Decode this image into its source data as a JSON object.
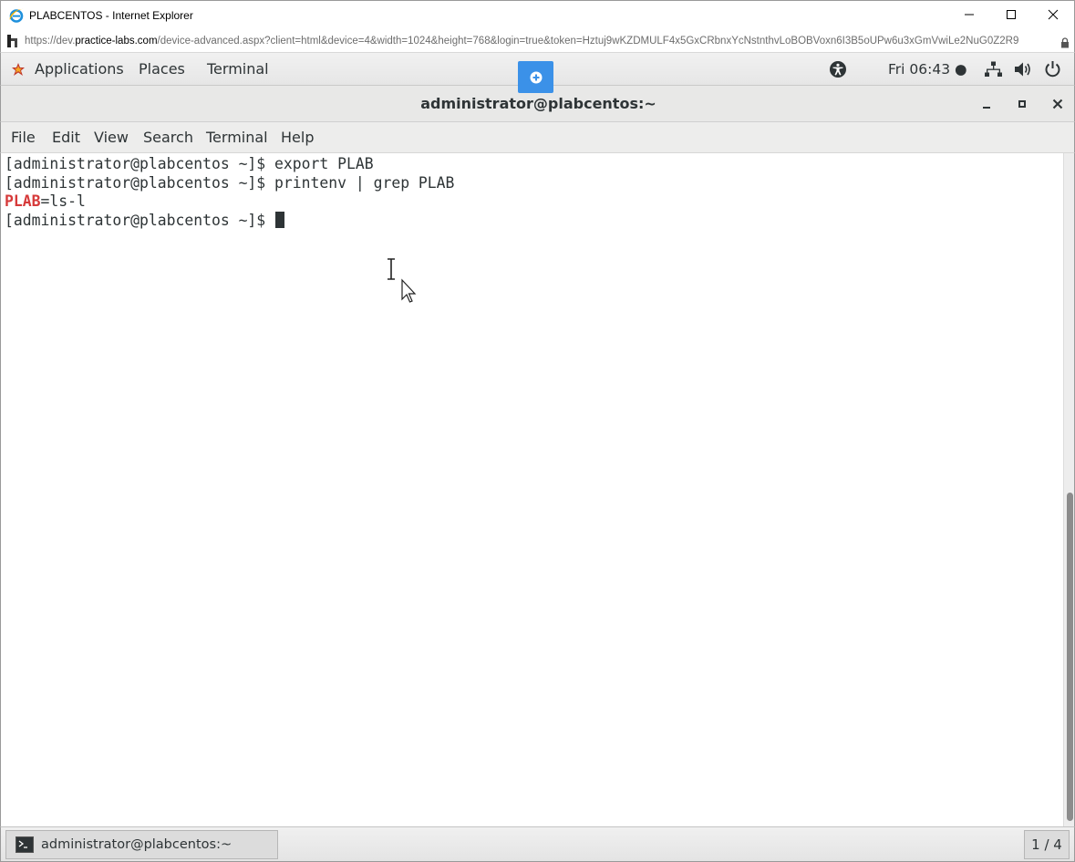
{
  "browser": {
    "title": "PLABCENTOS - Internet Explorer",
    "url_prefix": "https://dev.",
    "url_domain": "practice-labs.com",
    "url_rest": "/device-advanced.aspx?client=html&device=4&width=1024&height=768&login=true&token=Hztuj9wKZDMULF4x5GxCRbnxYcNstnthvLoBOBVoxn6I3B5oUPw6u3xGmVwiLe2NuG0Z2R9"
  },
  "gnome_topbar": {
    "applications": "Applications",
    "places": "Places",
    "terminal": "Terminal",
    "clock": "Fri 06:43 ●"
  },
  "terminal_window": {
    "title": "administrator@plabcentos:~",
    "menu": [
      "File",
      "Edit",
      "View",
      "Search",
      "Terminal",
      "Help"
    ],
    "lines": [
      "[administrator@plabcentos ~]$ export PLAB",
      "[administrator@plabcentos ~]$ printenv | grep PLAB"
    ],
    "match_highlight": "PLAB",
    "match_rest": "=ls-l",
    "prompt": "[administrator@plabcentos ~]$ "
  },
  "taskbar": {
    "window_label": "administrator@plabcentos:~",
    "workspace": "1 / 4"
  },
  "colors": {
    "remote_toggle": "#3b91e8",
    "grep_match": "#d63a3a",
    "ie_blue": "#1e90dc"
  }
}
